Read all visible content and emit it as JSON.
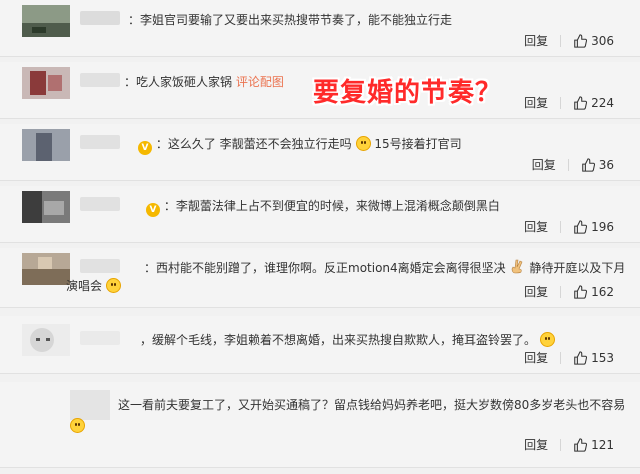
{
  "comments": [
    {
      "text": "李姐官司要输了又要出来买热搜带节奏了，能不能独立行走",
      "reply": "回复",
      "likes": "306"
    },
    {
      "text": "吃人家饭砸人家锅",
      "link": "评论配图",
      "reply": "回复",
      "likes": "224"
    },
    {
      "text_a": "这么久了 李靓蕾还不会独立行走吗",
      "text_b": "15号接着打官司",
      "reply": "回复",
      "likes": "36"
    },
    {
      "text": "李靓蕾法律上占不到便宜的时候，来微博上混淆概念颠倒黑白",
      "reply": "回复",
      "likes": "196"
    },
    {
      "line1_a": "西村能不能别蹭了，谁理你啊。反正motion4离婚定会离得很坚决",
      "line1_b": "静待开庭以及下月",
      "line2": "演唱会",
      "reply": "回复",
      "likes": "162"
    },
    {
      "text": "缓解个毛线，李姐赖着不想离婚，出来买热搜自欺欺人，掩耳盗铃罢了。",
      "reply": "回复",
      "likes": "153"
    },
    {
      "line1": "这一看前夫要复工了，又开始买通稿了？留点钱给妈妈养老吧，挺大岁数傍80多岁老头也不容易",
      "reply": "回复",
      "likes": "121"
    }
  ],
  "overlay": "要复婚的节奏？",
  "colors": {
    "accent_link": "#eb7350",
    "overlay_red": "#ff2a2a",
    "vip_gold": "#f5b800"
  },
  "icons": {
    "like": "thumbs-up-icon",
    "vip": "vip-badge-icon"
  }
}
